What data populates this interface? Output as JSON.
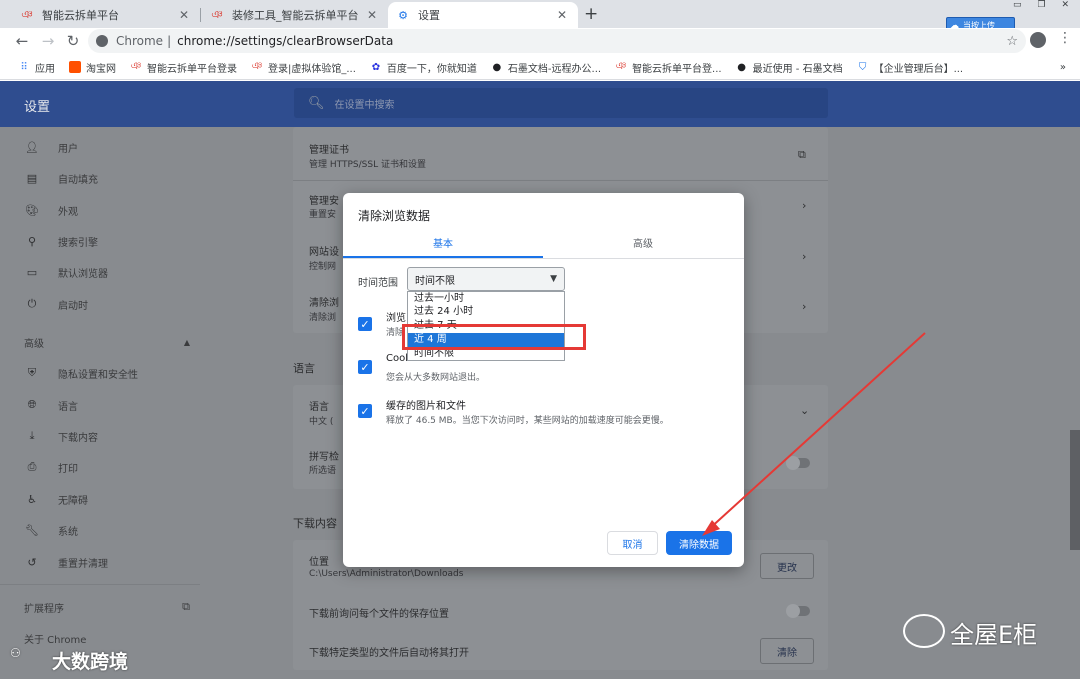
{
  "tabs": [
    {
      "title": "智能云拆单平台",
      "icon": "app-logo-icon"
    },
    {
      "title": "装修工具_智能云拆单平台",
      "icon": "app-logo-icon"
    },
    {
      "title": "设置",
      "icon": "gear-icon"
    }
  ],
  "new_tab": "+",
  "omnibox": {
    "site": "Chrome",
    "separator": "|",
    "url": "chrome://settings/clearBrowserData"
  },
  "bookmarks": [
    "应用",
    "淘宝网",
    "智能云拆单平台登录",
    "登录|虚拟体验馆_...",
    "百度一下，你就知道",
    "石墨文档-远程办公...",
    "智能云拆单平台登...",
    "最近使用 - 石墨文档",
    "【企业管理后台】..."
  ],
  "bookmarks_more": "»",
  "upload_badge": "当按上传",
  "header": {
    "title": "设置",
    "search_placeholder": "在设置中搜索"
  },
  "sidebar": {
    "items": [
      "用户",
      "自动填充",
      "外观",
      "搜索引擎",
      "默认浏览器",
      "启动时"
    ],
    "advanced": "高级",
    "advanced_items": [
      "隐私设置和安全性",
      "语言",
      "下载内容",
      "打印",
      "无障碍",
      "系统",
      "重置并清理"
    ],
    "extensions": "扩展程序",
    "about": "关于 Chrome"
  },
  "main": {
    "cert_title": "管理证书",
    "cert_sub": "管理 HTTPS/SSL 证书和设置",
    "security_title": "管理安",
    "security_sub": "重置安",
    "site_title": "网站设",
    "site_sub": "控制网",
    "clear_title": "清除浏",
    "clear_sub": "清除浏",
    "lang_section": "语言",
    "lang_title": "语言",
    "lang_sub": "中文 (",
    "spell_title": "拼写检",
    "spell_sub": "所选语",
    "download_section": "下载内容",
    "location_title": "位置",
    "location_path": "C:\\Users\\Administrator\\Downloads",
    "change_btn": "更改",
    "ask_location": "下载前询问每个文件的保存位置",
    "auto_open": "下载特定类型的文件后自动将其打开",
    "clear_btn": "清除"
  },
  "dialog": {
    "title": "清除浏览数据",
    "tab_basic": "基本",
    "tab_advanced": "高级",
    "range_label": "时间范围",
    "range_value": "时间不限",
    "options": [
      "过去一小时",
      "过去 24 小时",
      "过去 7 天",
      "近 4 周",
      "时间不限"
    ],
    "selected_option": "近 4 周",
    "history_title": "浏览",
    "history_sub": "清除",
    "cookies_title": "Cook",
    "cookies_sub": "您会从大多数网站退出。",
    "cache_title": "缓存的图片和文件",
    "cache_sub": "释放了 46.5 MB。当您下次访问时，某些网站的加载速度可能会更慢。",
    "cancel": "取消",
    "clear": "清除数据"
  },
  "watermarks": {
    "left": "大数跨境",
    "right": "全屋E柜"
  },
  "colors": {
    "header": "#2f4d8f",
    "accent": "#1a73e8",
    "highlight": "#e53935",
    "overlay": "#888b8f"
  }
}
